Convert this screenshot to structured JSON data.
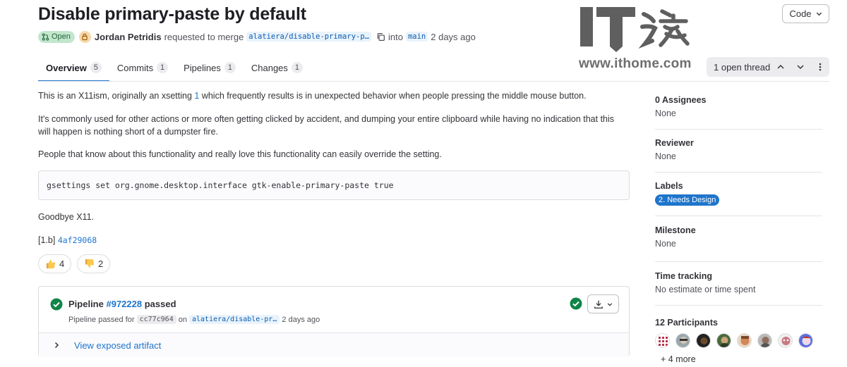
{
  "header": {
    "title": "Disable primary-paste by default",
    "status": "Open",
    "author": "Jordan Petridis",
    "action_text": "requested to merge",
    "source_branch": "alatiera/disable-primary-p…",
    "into_text": "into",
    "target_branch": "main",
    "time": "2 days ago",
    "code_button": "Code"
  },
  "tabs": [
    {
      "label": "Overview",
      "count": "5"
    },
    {
      "label": "Commits",
      "count": "1"
    },
    {
      "label": "Pipelines",
      "count": "1"
    },
    {
      "label": "Changes",
      "count": "1"
    }
  ],
  "thread": {
    "label": "1 open thread"
  },
  "watermark": {
    "url": "www.ithome.com",
    "brand": "IT之家"
  },
  "description": {
    "p1_before": "This is an X11ism, originally an xsetting ",
    "p1_link": "1",
    "p1_after": " which frequently results is in unexpected behavior when people pressing the middle mouse button.",
    "p2": "It's commonly used for other actions or more often getting clicked by accident, and dumping your entire clipboard while having no indication that this will happen is nothing short of a dumpster fire.",
    "p3": "People that know about this functionality and really love this functionality can easily override the setting.",
    "code": "gsettings set org.gnome.desktop.interface gtk-enable-primary-paste true",
    "p4": "Goodbye X11.",
    "p5_prefix": "[1.b]",
    "p5_sha": "4af29068"
  },
  "reactions": {
    "thumbs_up": "4",
    "thumbs_down": "2"
  },
  "pipeline": {
    "title_prefix": "Pipeline",
    "id": "#972228",
    "title_suffix": "passed",
    "sub_prefix": "Pipeline passed for",
    "commit": "cc77c964",
    "on_text": "on",
    "branch": "alatiera/disable-pr…",
    "time": "2 days ago",
    "artifact_label": "View exposed artifact"
  },
  "sidebar": {
    "assignees_title": "0 Assignees",
    "assignees_value": "None",
    "reviewer_title": "Reviewer",
    "reviewer_value": "None",
    "labels_title": "Labels",
    "label": "2. Needs Design",
    "milestone_title": "Milestone",
    "milestone_value": "None",
    "time_title": "Time tracking",
    "time_value": "No estimate or time spent",
    "participants_title": "12 Participants",
    "participants_more": "+ 4 more"
  },
  "colors": {
    "accent": "#1f75cb",
    "success": "#108548",
    "open_badge_bg": "#c3e6cd"
  }
}
